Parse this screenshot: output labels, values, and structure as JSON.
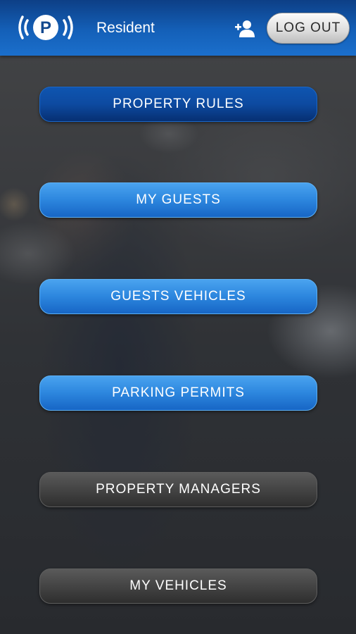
{
  "header": {
    "logo_letter": "P",
    "role_label": "Resident",
    "user_icon": "add-user-icon",
    "logout_label": "LOG OUT",
    "colors": {
      "header_top": "#0d3f86",
      "header_bottom": "#1b6fcc"
    }
  },
  "menu": {
    "items": [
      {
        "label": "PROPERTY RULES",
        "style": "blue-dark"
      },
      {
        "label": "MY GUESTS",
        "style": "blue"
      },
      {
        "label": "GUESTS VEHICLES",
        "style": "blue"
      },
      {
        "label": "PARKING PERMITS",
        "style": "blue"
      },
      {
        "label": "PROPERTY MANAGERS",
        "style": "gray"
      },
      {
        "label": "MY VEHICLES",
        "style": "gray"
      }
    ]
  }
}
